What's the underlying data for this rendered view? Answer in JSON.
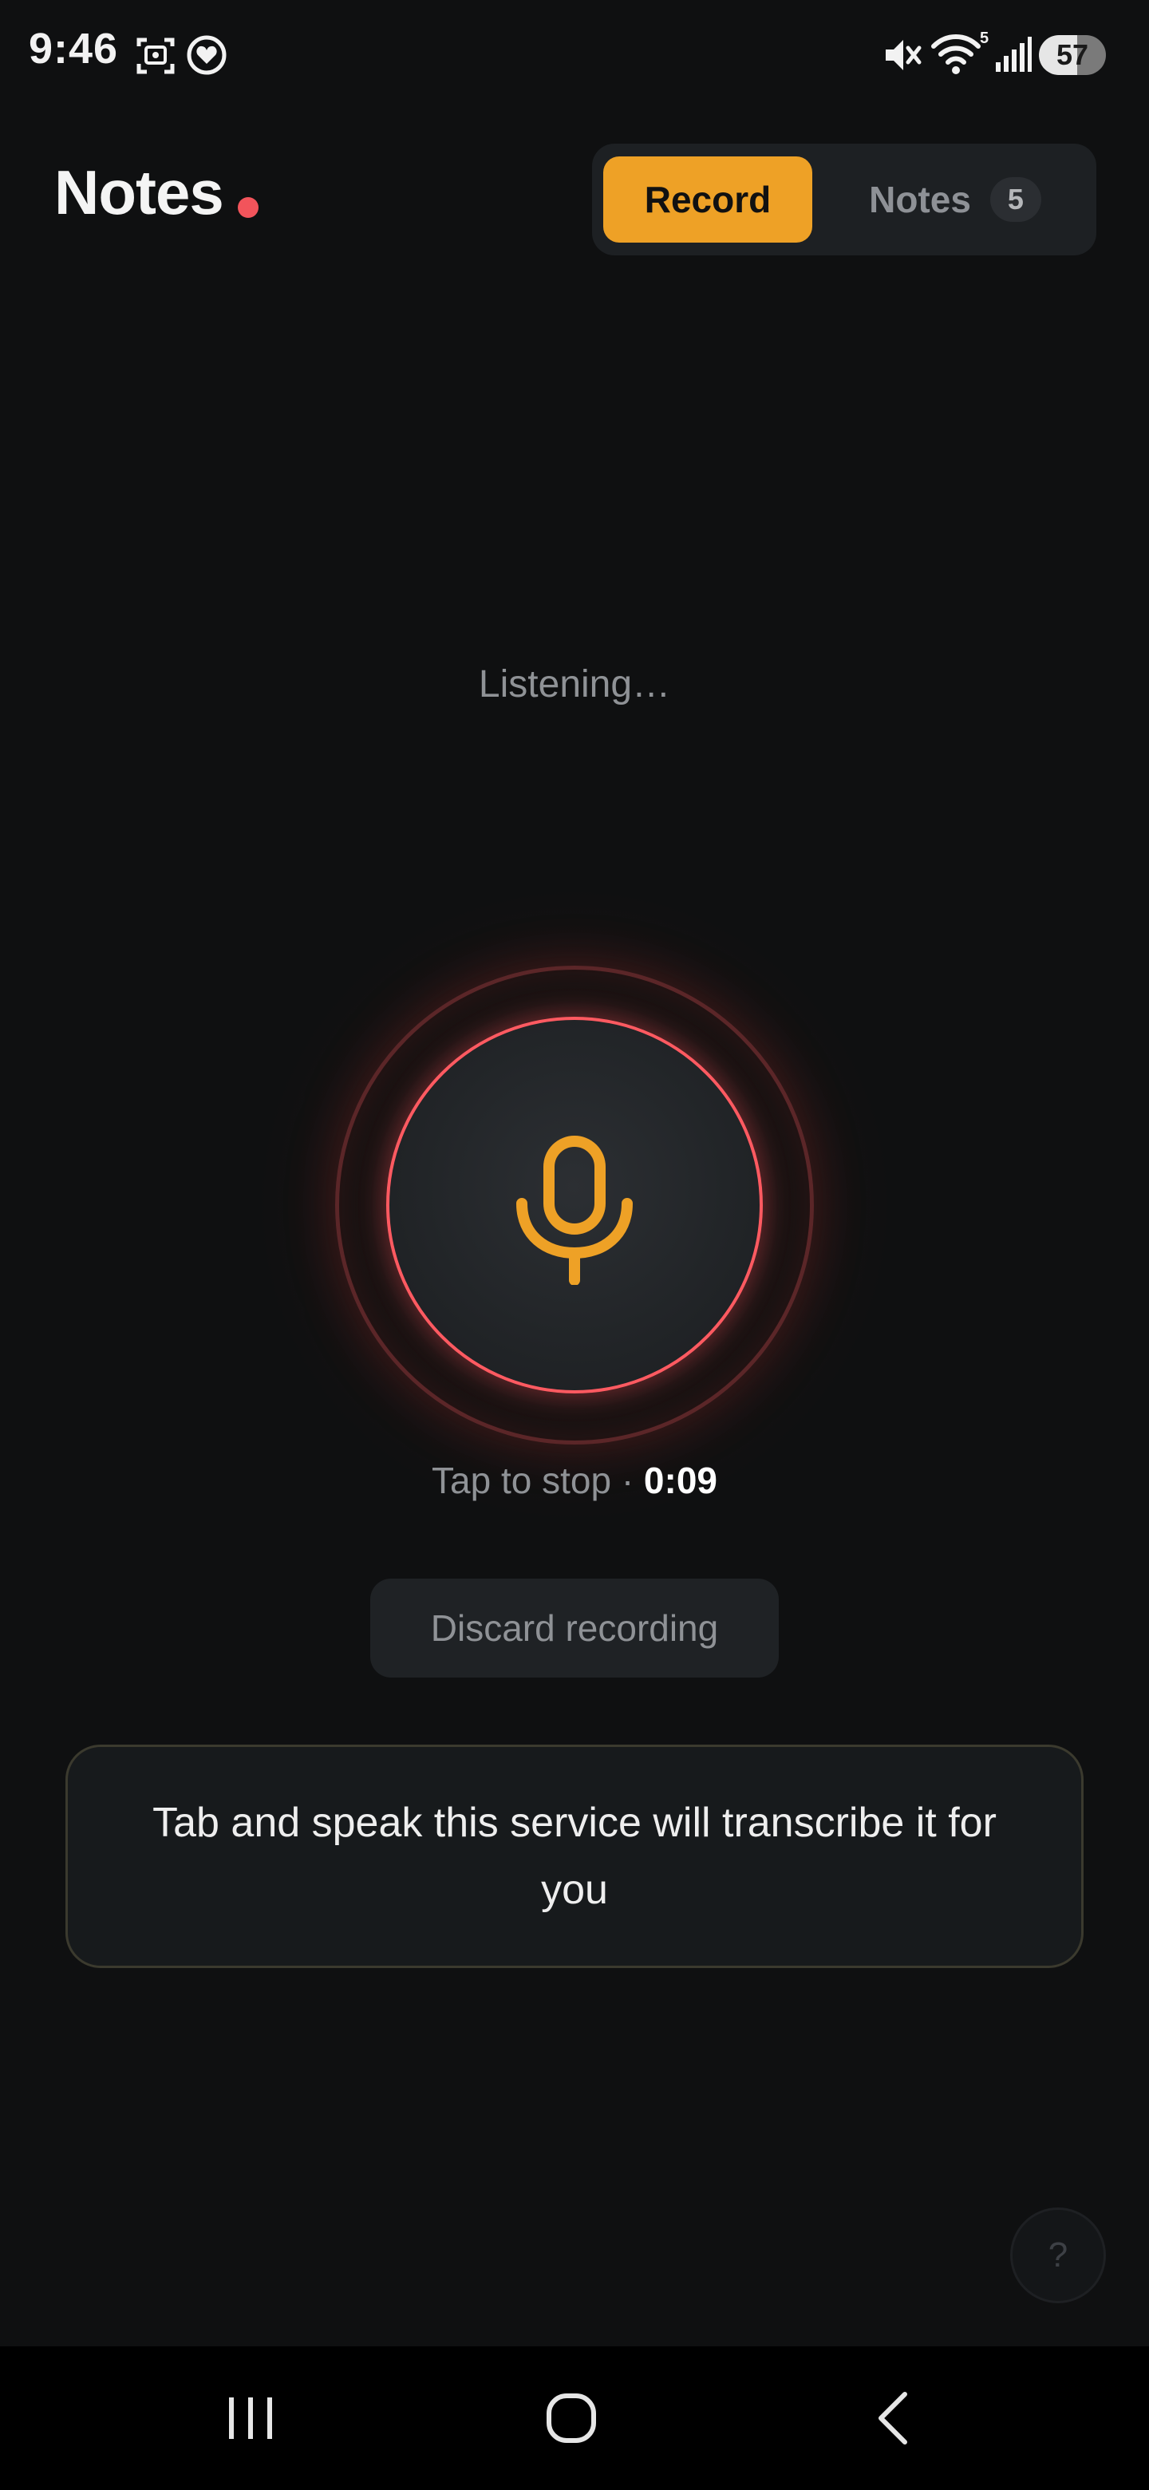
{
  "status_bar": {
    "time": "9:46",
    "battery_level": "57",
    "battery_fraction": 0.57,
    "wifi_badge": "5",
    "icons": [
      "screenshot-icon",
      "heart-icon",
      "mute-icon",
      "wifi-icon",
      "signal-icon",
      "battery-icon"
    ]
  },
  "header": {
    "title": "Notes",
    "live_dot_color": "#f2545b"
  },
  "tabs": {
    "record_label": "Record",
    "notes_label": "Notes",
    "notes_count": "5",
    "active": "Record",
    "accent_color": "#eea126"
  },
  "recorder": {
    "status": "Listening…",
    "mic_icon": "microphone-icon",
    "ring_color": "#ff5a61",
    "tap_label": "Tap to stop · ",
    "timer": "0:09",
    "discard_label": "Discard recording"
  },
  "hint": {
    "text": "Tab and speak this service will transcribe it for you"
  },
  "help": {
    "label": "?"
  },
  "nav": {
    "icons": [
      "recent-apps-icon",
      "home-icon",
      "back-icon"
    ]
  }
}
